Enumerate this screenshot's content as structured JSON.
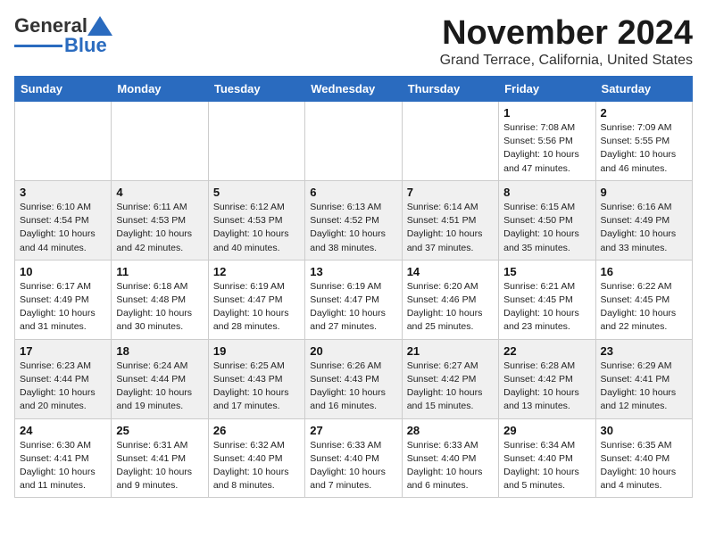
{
  "header": {
    "logo_general": "General",
    "logo_blue": "Blue",
    "month": "November 2024",
    "location": "Grand Terrace, California, United States"
  },
  "weekdays": [
    "Sunday",
    "Monday",
    "Tuesday",
    "Wednesday",
    "Thursday",
    "Friday",
    "Saturday"
  ],
  "weeks": [
    [
      {
        "day": "",
        "info": ""
      },
      {
        "day": "",
        "info": ""
      },
      {
        "day": "",
        "info": ""
      },
      {
        "day": "",
        "info": ""
      },
      {
        "day": "",
        "info": ""
      },
      {
        "day": "1",
        "info": "Sunrise: 7:08 AM\nSunset: 5:56 PM\nDaylight: 10 hours and 47 minutes."
      },
      {
        "day": "2",
        "info": "Sunrise: 7:09 AM\nSunset: 5:55 PM\nDaylight: 10 hours and 46 minutes."
      }
    ],
    [
      {
        "day": "3",
        "info": "Sunrise: 6:10 AM\nSunset: 4:54 PM\nDaylight: 10 hours and 44 minutes."
      },
      {
        "day": "4",
        "info": "Sunrise: 6:11 AM\nSunset: 4:53 PM\nDaylight: 10 hours and 42 minutes."
      },
      {
        "day": "5",
        "info": "Sunrise: 6:12 AM\nSunset: 4:53 PM\nDaylight: 10 hours and 40 minutes."
      },
      {
        "day": "6",
        "info": "Sunrise: 6:13 AM\nSunset: 4:52 PM\nDaylight: 10 hours and 38 minutes."
      },
      {
        "day": "7",
        "info": "Sunrise: 6:14 AM\nSunset: 4:51 PM\nDaylight: 10 hours and 37 minutes."
      },
      {
        "day": "8",
        "info": "Sunrise: 6:15 AM\nSunset: 4:50 PM\nDaylight: 10 hours and 35 minutes."
      },
      {
        "day": "9",
        "info": "Sunrise: 6:16 AM\nSunset: 4:49 PM\nDaylight: 10 hours and 33 minutes."
      }
    ],
    [
      {
        "day": "10",
        "info": "Sunrise: 6:17 AM\nSunset: 4:49 PM\nDaylight: 10 hours and 31 minutes."
      },
      {
        "day": "11",
        "info": "Sunrise: 6:18 AM\nSunset: 4:48 PM\nDaylight: 10 hours and 30 minutes."
      },
      {
        "day": "12",
        "info": "Sunrise: 6:19 AM\nSunset: 4:47 PM\nDaylight: 10 hours and 28 minutes."
      },
      {
        "day": "13",
        "info": "Sunrise: 6:19 AM\nSunset: 4:47 PM\nDaylight: 10 hours and 27 minutes."
      },
      {
        "day": "14",
        "info": "Sunrise: 6:20 AM\nSunset: 4:46 PM\nDaylight: 10 hours and 25 minutes."
      },
      {
        "day": "15",
        "info": "Sunrise: 6:21 AM\nSunset: 4:45 PM\nDaylight: 10 hours and 23 minutes."
      },
      {
        "day": "16",
        "info": "Sunrise: 6:22 AM\nSunset: 4:45 PM\nDaylight: 10 hours and 22 minutes."
      }
    ],
    [
      {
        "day": "17",
        "info": "Sunrise: 6:23 AM\nSunset: 4:44 PM\nDaylight: 10 hours and 20 minutes."
      },
      {
        "day": "18",
        "info": "Sunrise: 6:24 AM\nSunset: 4:44 PM\nDaylight: 10 hours and 19 minutes."
      },
      {
        "day": "19",
        "info": "Sunrise: 6:25 AM\nSunset: 4:43 PM\nDaylight: 10 hours and 17 minutes."
      },
      {
        "day": "20",
        "info": "Sunrise: 6:26 AM\nSunset: 4:43 PM\nDaylight: 10 hours and 16 minutes."
      },
      {
        "day": "21",
        "info": "Sunrise: 6:27 AM\nSunset: 4:42 PM\nDaylight: 10 hours and 15 minutes."
      },
      {
        "day": "22",
        "info": "Sunrise: 6:28 AM\nSunset: 4:42 PM\nDaylight: 10 hours and 13 minutes."
      },
      {
        "day": "23",
        "info": "Sunrise: 6:29 AM\nSunset: 4:41 PM\nDaylight: 10 hours and 12 minutes."
      }
    ],
    [
      {
        "day": "24",
        "info": "Sunrise: 6:30 AM\nSunset: 4:41 PM\nDaylight: 10 hours and 11 minutes."
      },
      {
        "day": "25",
        "info": "Sunrise: 6:31 AM\nSunset: 4:41 PM\nDaylight: 10 hours and 9 minutes."
      },
      {
        "day": "26",
        "info": "Sunrise: 6:32 AM\nSunset: 4:40 PM\nDaylight: 10 hours and 8 minutes."
      },
      {
        "day": "27",
        "info": "Sunrise: 6:33 AM\nSunset: 4:40 PM\nDaylight: 10 hours and 7 minutes."
      },
      {
        "day": "28",
        "info": "Sunrise: 6:33 AM\nSunset: 4:40 PM\nDaylight: 10 hours and 6 minutes."
      },
      {
        "day": "29",
        "info": "Sunrise: 6:34 AM\nSunset: 4:40 PM\nDaylight: 10 hours and 5 minutes."
      },
      {
        "day": "30",
        "info": "Sunrise: 6:35 AM\nSunset: 4:40 PM\nDaylight: 10 hours and 4 minutes."
      }
    ]
  ]
}
